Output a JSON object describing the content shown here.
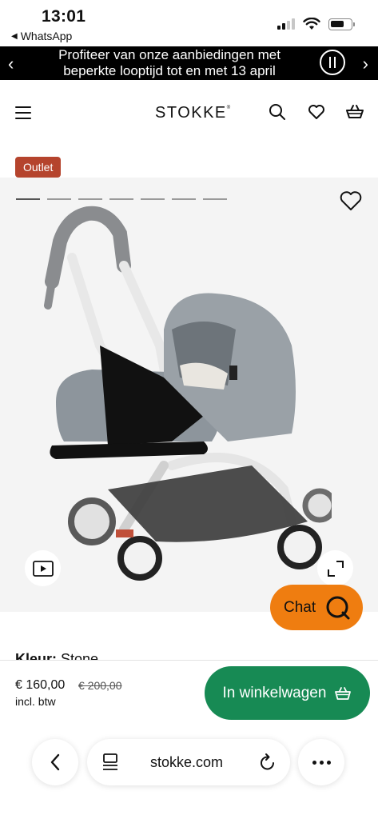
{
  "status_bar": {
    "time": "13:01",
    "back_app": "WhatsApp",
    "battery_level": 0.7,
    "signal_bars_active": 2,
    "signal_bars_total": 4
  },
  "promo": {
    "text": "Profiteer van onze aanbiedingen met beperkte looptijd tot en met 13 april",
    "prev_glyph": "‹",
    "next_glyph": "›"
  },
  "header": {
    "logo": "STOKKE",
    "logo_mark": "®"
  },
  "product": {
    "badge": "Outlet",
    "gallery_slide_count": 7,
    "gallery_active_index": 0,
    "colour_label": "Kleur:",
    "colour_value": "Stone"
  },
  "chat": {
    "label": "Chat"
  },
  "purchase": {
    "price": "€ 160,00",
    "old_price": "€ 200,00",
    "tax_note": "incl. btw",
    "cart_label": "In winkelwagen"
  },
  "browser": {
    "url": "stokke.com"
  },
  "colors": {
    "promo_bg": "#000000",
    "badge_bg": "#b5442d",
    "chat_bg": "#ef7d10",
    "cart_bg": "#178a54",
    "gallery_bg": "#f4f4f4"
  },
  "icons": {
    "menu": "hamburger-icon",
    "search": "search-icon",
    "wishlist": "heart-icon",
    "basket": "basket-icon",
    "video": "play-icon",
    "expand": "expand-icon",
    "chat": "chat-q-icon"
  }
}
